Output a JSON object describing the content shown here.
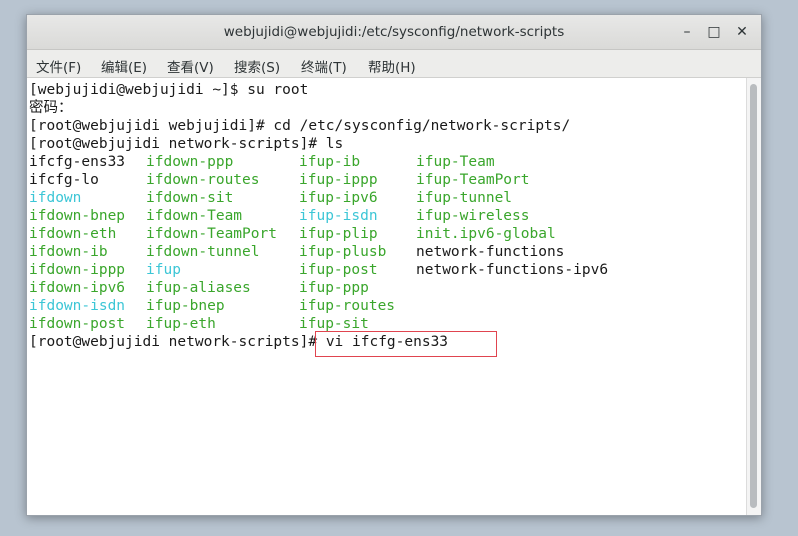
{
  "window": {
    "title": "webjujidi@webjujidi:/etc/sysconfig/network-scripts",
    "controls": {
      "minimize": "–",
      "maximize": "□",
      "close": "✕"
    }
  },
  "menu": [
    "文件(F)",
    "编辑(E)",
    "查看(V)",
    "搜索(S)",
    "终端(T)",
    "帮助(H)"
  ],
  "terminal": {
    "lines": [
      "[webjujidi@webjujidi ~]$ su root",
      "密码：",
      "[root@webjujidi webjujidi]# cd /etc/sysconfig/network-scripts/",
      "[root@webjujidi network-scripts]# ls"
    ],
    "listing": [
      [
        "ifcfg-ens33",
        "ifdown-ppp",
        "ifup-ib",
        "ifup-Team"
      ],
      [
        "ifcfg-lo",
        "ifdown-routes",
        "ifup-ippp",
        "ifup-TeamPort"
      ],
      [
        "ifdown",
        "ifdown-sit",
        "ifup-ipv6",
        "ifup-tunnel"
      ],
      [
        "ifdown-bnep",
        "ifdown-Team",
        "ifup-isdn",
        "ifup-wireless"
      ],
      [
        "ifdown-eth",
        "ifdown-TeamPort",
        "ifup-plip",
        "init.ipv6-global"
      ],
      [
        "ifdown-ib",
        "ifdown-tunnel",
        "ifup-plusb",
        "network-functions"
      ],
      [
        "ifdown-ippp",
        "ifup",
        "ifup-post",
        "network-functions-ipv6"
      ],
      [
        "ifdown-ipv6",
        "ifup-aliases",
        "ifup-ppp",
        ""
      ],
      [
        "ifdown-isdn",
        "ifup-bnep",
        "ifup-routes",
        ""
      ],
      [
        "ifdown-post",
        "ifup-eth",
        "ifup-sit",
        ""
      ]
    ],
    "listing_colors": [
      [
        "#1a1a1a",
        "#3aa62c",
        "#3aa62c",
        "#3aa62c"
      ],
      [
        "#1a1a1a",
        "#3aa62c",
        "#3aa62c",
        "#3aa62c"
      ],
      [
        "#3cc6d6",
        "#3aa62c",
        "#3aa62c",
        "#3aa62c"
      ],
      [
        "#3aa62c",
        "#3aa62c",
        "#3cc6d6",
        "#3aa62c"
      ],
      [
        "#3aa62c",
        "#3aa62c",
        "#3aa62c",
        "#3aa62c"
      ],
      [
        "#3aa62c",
        "#3aa62c",
        "#3aa62c",
        "#1a1a1a"
      ],
      [
        "#3aa62c",
        "#3cc6d6",
        "#3aa62c",
        "#1a1a1a"
      ],
      [
        "#3aa62c",
        "#3aa62c",
        "#3aa62c",
        ""
      ],
      [
        "#3cc6d6",
        "#3aa62c",
        "#3aa62c",
        ""
      ],
      [
        "#3aa62c",
        "#3aa62c",
        "#3aa62c",
        ""
      ]
    ],
    "last_prompt": "[root@webjujidi network-scripts]",
    "last_command": "# vi ifcfg-ens33"
  },
  "colors": {
    "executable": "#3aa62c",
    "symlink": "#3cc6d6",
    "plain": "#1a1a1a",
    "highlight_box": "#e0444f"
  }
}
